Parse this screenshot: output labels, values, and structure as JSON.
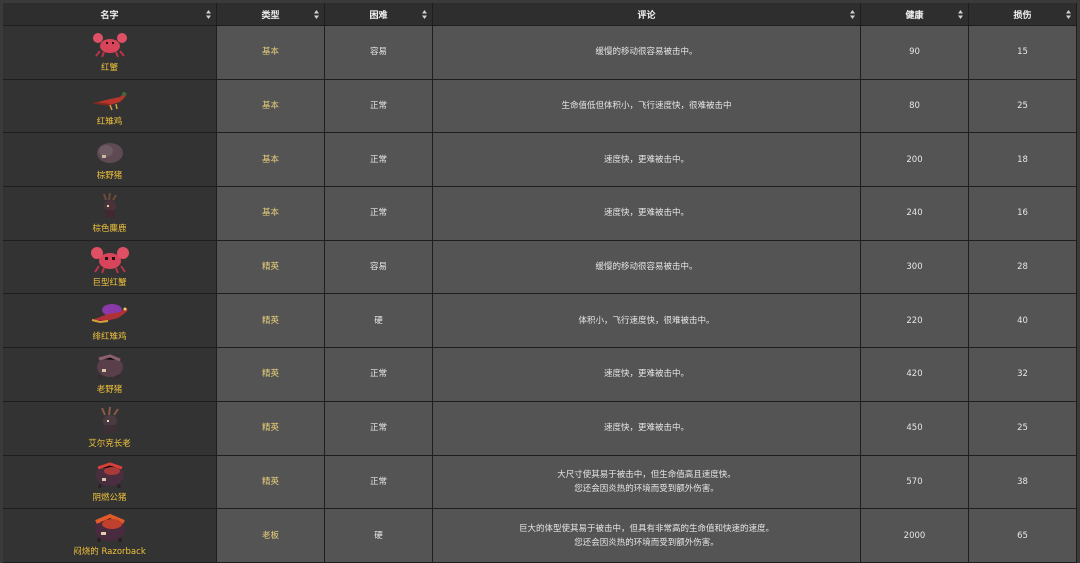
{
  "columns": [
    {
      "key": "name",
      "label": "名字"
    },
    {
      "key": "type",
      "label": "类型"
    },
    {
      "key": "difficulty",
      "label": "困难"
    },
    {
      "key": "comment",
      "label": "评论"
    },
    {
      "key": "health",
      "label": "健康"
    },
    {
      "key": "damage",
      "label": "损伤"
    }
  ],
  "rows": [
    {
      "name": "红蟹",
      "sprite": "red-crab-icon",
      "type": "基本",
      "difficulty": "容易",
      "comment": [
        "缓慢的移动很容易被击中。"
      ],
      "health": "90",
      "damage": "15"
    },
    {
      "name": "红雉鸡",
      "sprite": "red-pheasant-icon",
      "type": "基本",
      "difficulty": "正常",
      "comment": [
        "生命值低但体积小，飞行速度快，很难被击中"
      ],
      "health": "80",
      "damage": "25"
    },
    {
      "name": "棕野猪",
      "sprite": "brown-boar-icon",
      "type": "基本",
      "difficulty": "正常",
      "comment": [
        "速度快，更难被击中。"
      ],
      "health": "200",
      "damage": "18"
    },
    {
      "name": "棕色麋鹿",
      "sprite": "brown-elk-icon",
      "type": "基本",
      "difficulty": "正常",
      "comment": [
        "速度快，更难被击中。"
      ],
      "health": "240",
      "damage": "16"
    },
    {
      "name": "巨型红蟹",
      "sprite": "giant-red-crab-icon",
      "type": "精英",
      "difficulty": "容易",
      "comment": [
        "缓慢的移动很容易被击中。"
      ],
      "health": "300",
      "damage": "28"
    },
    {
      "name": "绯红雉鸡",
      "sprite": "crimson-pheasant-icon",
      "type": "精英",
      "difficulty": "硬",
      "comment": [
        "体积小，飞行速度快，很难被击中。"
      ],
      "health": "220",
      "damage": "40"
    },
    {
      "name": "老野猪",
      "sprite": "old-boar-icon",
      "type": "精英",
      "difficulty": "正常",
      "comment": [
        "速度快，更难被击中。"
      ],
      "health": "420",
      "damage": "32"
    },
    {
      "name": "艾尔克长老",
      "sprite": "elk-elder-icon",
      "type": "精英",
      "difficulty": "正常",
      "comment": [
        "速度快，更难被击中。"
      ],
      "health": "450",
      "damage": "25"
    },
    {
      "name": "阴燃公猪",
      "sprite": "smoldering-boar-icon",
      "type": "精英",
      "difficulty": "正常",
      "comment": [
        "大尺寸使其易于被击中，但生命值高且速度快。",
        "您还会因炎热的环境而受到额外伤害。"
      ],
      "health": "570",
      "damage": "38"
    },
    {
      "name": "闷烧的 Razorback",
      "sprite": "smoldering-razorback-icon",
      "type": "老板",
      "difficulty": "硬",
      "comment": [
        "巨大的体型使其易于被击中，但具有非常高的生命值和快速的速度。",
        "您还会因炎热的环境而受到额外伤害。"
      ],
      "health": "2000",
      "damage": "65"
    }
  ],
  "colors": {
    "header_bg": "#2e2e2e",
    "name_cell_bg": "#333333",
    "cell_bg": "#545454",
    "name_text": "#f0c23c",
    "type_text": "#e8cf7a"
  }
}
